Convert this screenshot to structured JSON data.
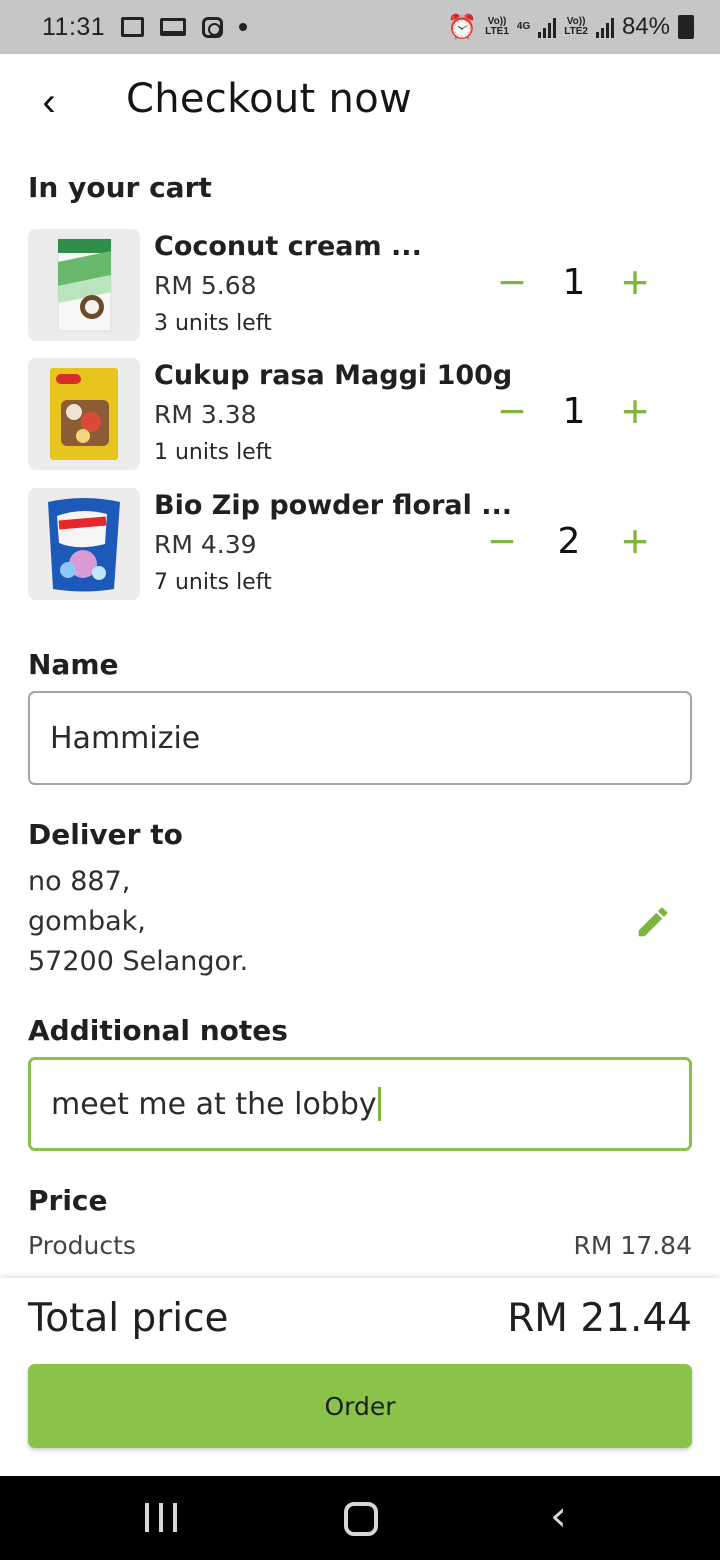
{
  "status_bar": {
    "time": "11:31",
    "battery": "84%",
    "network_1_label": "LTE1",
    "network_2_label": "LTE2",
    "network_badge_1": "Vo))",
    "network_badge_2": "4G",
    "network_badge_3": "Vo))"
  },
  "header": {
    "back_icon": "chevron-left-icon",
    "title": "Checkout now"
  },
  "cart": {
    "title": "In your cart",
    "items": [
      {
        "name": "Coconut cream ...",
        "price": "RM 5.68",
        "stock": "3 units left",
        "quantity": "1",
        "minus": "−",
        "plus": "+"
      },
      {
        "name": "Cukup rasa Maggi 100g",
        "price": "RM 3.38",
        "stock": "1 units left",
        "quantity": "1",
        "minus": "−",
        "plus": "+"
      },
      {
        "name": "Bio Zip powder floral ...",
        "price": "RM 4.39",
        "stock": "7 units left",
        "quantity": "2",
        "minus": "−",
        "plus": "+"
      }
    ]
  },
  "form": {
    "name_label": "Name",
    "name_value": "Hammizie",
    "deliver_label": "Deliver to",
    "address_lines": [
      "no 887,",
      "gombak,",
      "57200 Selangor."
    ],
    "notes_label": "Additional notes",
    "notes_value": "meet me at the lobby"
  },
  "price": {
    "title": "Price",
    "products_label": "Products",
    "products_value": "RM 17.84"
  },
  "summary": {
    "total_label": "Total price",
    "total_value": "RM 21.44",
    "order_label": "Order"
  },
  "colors": {
    "accent": "#8bc34a",
    "accent_dark": "#7db63f",
    "status_bar": "#c6c6c6",
    "navigation_bar": "#000000"
  }
}
